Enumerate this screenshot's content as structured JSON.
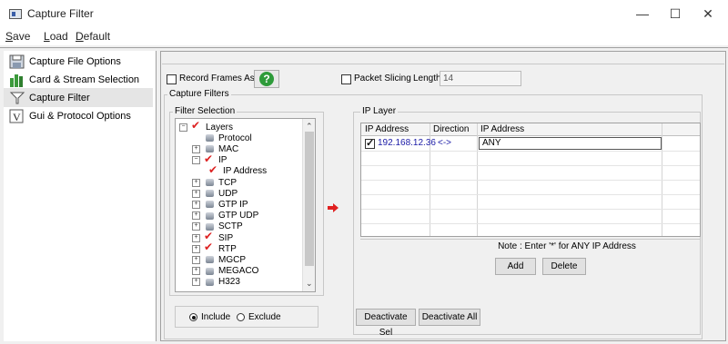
{
  "window": {
    "title": "Capture Filter",
    "minimize": "—",
    "maximize": "☐",
    "close": "✕"
  },
  "menu": [
    "Save",
    "Load",
    "Default"
  ],
  "nav": {
    "items": [
      {
        "label": "Capture File Options",
        "icon": "disk-icon"
      },
      {
        "label": "Card & Stream Selection",
        "icon": "bars-icon"
      },
      {
        "label": "Capture Filter",
        "icon": "funnel-icon",
        "selected": true
      },
      {
        "label": "Gui & Protocol Options",
        "icon": "v-icon"
      }
    ]
  },
  "options": {
    "record_frames_label": "Record Frames As Is",
    "help_icon": "?",
    "packet_slicing_label": "Packet Slicing",
    "length_label": "Length",
    "length_value": "14"
  },
  "capture_filters": {
    "label": "Capture Filters",
    "filter_selection_label": "Filter Selection",
    "tree": [
      {
        "label": "Layers",
        "expander": "−",
        "checked": true,
        "indent": 0
      },
      {
        "label": "Protocol",
        "expander": "",
        "checked": false,
        "indent": 1
      },
      {
        "label": "MAC",
        "expander": "+",
        "checked": false,
        "indent": 1
      },
      {
        "label": "IP",
        "expander": "−",
        "checked": true,
        "indent": 1
      },
      {
        "label": "IP Address",
        "expander": "",
        "checked": true,
        "indent": 2
      },
      {
        "label": "TCP",
        "expander": "+",
        "checked": false,
        "indent": 1
      },
      {
        "label": "UDP",
        "expander": "+",
        "checked": false,
        "indent": 1
      },
      {
        "label": "GTP IP",
        "expander": "+",
        "checked": false,
        "indent": 1
      },
      {
        "label": "GTP UDP",
        "expander": "+",
        "checked": false,
        "indent": 1
      },
      {
        "label": "SCTP",
        "expander": "+",
        "checked": false,
        "indent": 1
      },
      {
        "label": "SIP",
        "expander": "+",
        "checked": true,
        "indent": 1
      },
      {
        "label": "RTP",
        "expander": "+",
        "checked": true,
        "indent": 1
      },
      {
        "label": "MGCP",
        "expander": "+",
        "checked": false,
        "indent": 1
      },
      {
        "label": "MEGACO",
        "expander": "+",
        "checked": false,
        "indent": 1
      },
      {
        "label": "H323",
        "expander": "+",
        "checked": false,
        "indent": 1
      }
    ],
    "include_label": "Include",
    "exclude_label": "Exclude",
    "mode": "include"
  },
  "ip_layer": {
    "label": "IP Layer",
    "columns": [
      "IP Address",
      "Direction",
      "IP Address"
    ],
    "rows": [
      {
        "checked": true,
        "ip": "192.168.12.36",
        "direction": "<->",
        "ip2": "ANY"
      }
    ],
    "note": "Note : Enter '*' for ANY IP Address",
    "add_label": "Add",
    "delete_label": "Delete",
    "deactivate_sel_label": "Deactivate Sel",
    "deactivate_all_label": "Deactivate All"
  },
  "colors": {
    "accent_arrow": "#e02020",
    "help_green": "#2e9b3a",
    "ip_text": "#1a1aa6"
  }
}
